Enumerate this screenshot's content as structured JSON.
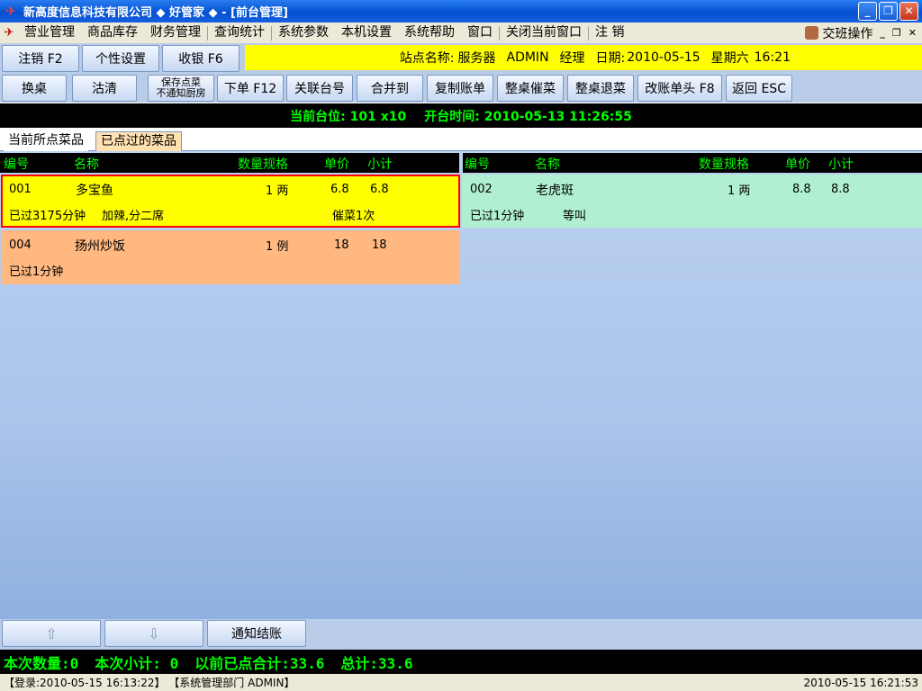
{
  "window": {
    "title": "新高度信息科技有限公司 ◆ 好管家 ◆ - [前台管理]",
    "minimize": "_",
    "restore": "❐",
    "close": "✕"
  },
  "menu": {
    "items": [
      "营业管理",
      "商品库存",
      "财务管理",
      "查询统计",
      "系统参数",
      "本机设置",
      "系统帮助",
      "窗口",
      "关闭当前窗口",
      "注  销"
    ],
    "handover": "交班操作",
    "mdi_min": "_",
    "mdi_restore": "❐",
    "mdi_close": "✕"
  },
  "toolbar1": {
    "logout": "注销 F2",
    "personal": "个性设置",
    "checkout": "收银 F6"
  },
  "infobar": {
    "site_label": "站点名称:",
    "site_value": "服务器",
    "user": "ADMIN",
    "role": "经理",
    "date_label": "日期:",
    "date_value": "2010-05-15",
    "weekday": "星期六",
    "time": "16:21"
  },
  "toolbar2": {
    "change_table": "换桌",
    "clear": "沽清",
    "save_line1": "保存点菜",
    "save_line2": "不通知厨房",
    "place_order": "下单 F12",
    "link_table": "关联台号",
    "merge": "合并到",
    "copy_bill": "复制账单",
    "rush_table": "整桌催菜",
    "return_table": "整桌退菜",
    "edit_header": "改账单头 F8",
    "back": "返回 ESC"
  },
  "tablebar": {
    "table_label": "当前台位:",
    "table_value": "101 x10",
    "open_label": "开台时间:",
    "open_value": "2010-05-13 11:26:55"
  },
  "tabs": {
    "current": "当前所点菜品",
    "ordered": "已点过的菜品"
  },
  "columns": {
    "code": "编号",
    "name": "名称",
    "qty": "数量规格",
    "price": "单价",
    "subtotal": "小计"
  },
  "items": [
    {
      "code": "001",
      "name": "多宝鱼",
      "qty": "1 两",
      "price": "6.8",
      "subtotal": "6.8",
      "elapsed": "已过3175分钟",
      "note": "加辣,分二席",
      "status": "催菜1次",
      "color": "#ffff00"
    },
    {
      "code": "002",
      "name": "老虎斑",
      "qty": "1 两",
      "price": "8.8",
      "subtotal": "8.8",
      "elapsed": "已过1分钟",
      "note": "等叫",
      "status": "",
      "color": "#b0f0d0"
    },
    {
      "code": "004",
      "name": "扬州炒饭",
      "qty": "1 例",
      "price": "18",
      "subtotal": "18",
      "elapsed": "已过1分钟",
      "note": "",
      "status": "",
      "color": "#ffb880"
    }
  ],
  "bottom": {
    "up_icon": "⇧",
    "down_icon": "⇩",
    "notify_checkout": "通知结账"
  },
  "totals": {
    "qty_label": "本次数量:",
    "qty_value": "0",
    "subtotal_label": "本次小计:",
    "subtotal_value": "0",
    "prev_label": "以前已点合计:",
    "prev_value": "33.6",
    "total_label": "总计:",
    "total_value": "33.6"
  },
  "status": {
    "login": "【登录:2010-05-15 16:13:22】 【系统管理部门 ADMIN】",
    "clock": "2010-05-15 16:21:53"
  },
  "colors": {
    "selected_border": "#ff0000",
    "accent_green": "#00ff00",
    "info_yellow": "#ffff00"
  }
}
